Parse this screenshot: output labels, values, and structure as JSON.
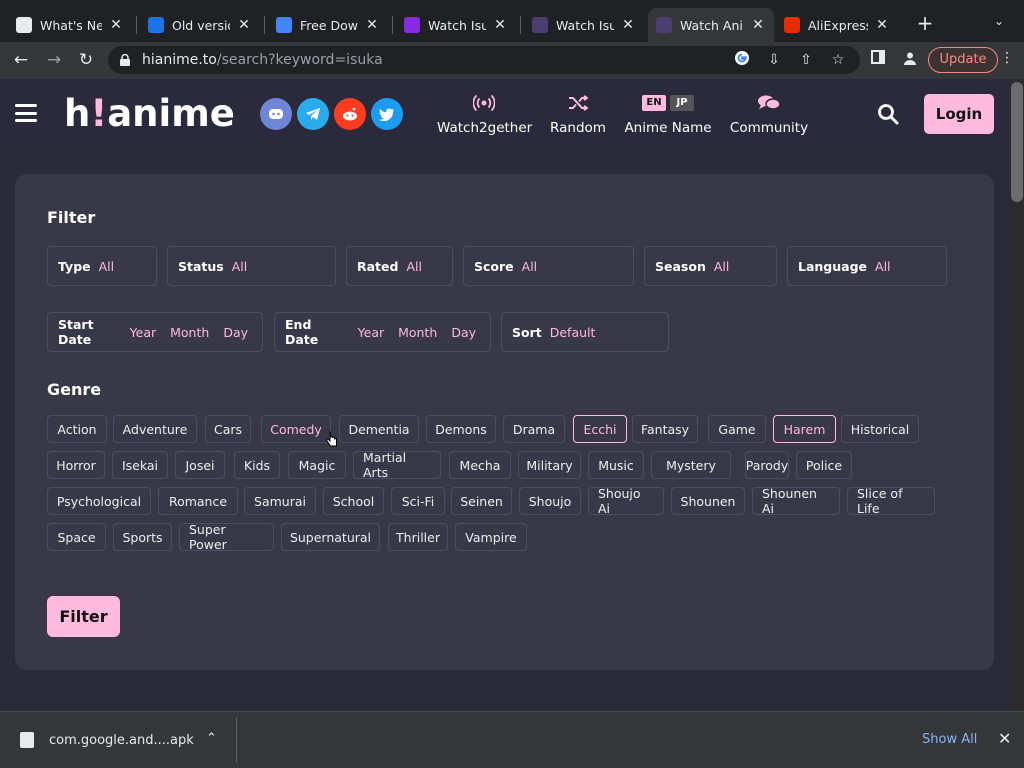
{
  "browser": {
    "tabs": [
      {
        "title": "What's New",
        "icon": "chrome-icon",
        "color": "#e8eaed"
      },
      {
        "title": "Old version",
        "icon": "ov-icon",
        "color": "#1a73e8"
      },
      {
        "title": "Free Downl",
        "icon": "download-site-icon",
        "color": "#4285f4"
      },
      {
        "title": "Watch Isuc",
        "icon": "play-icon",
        "color": "#8a2be2"
      },
      {
        "title": "Watch Isuc",
        "icon": "hianime-icon",
        "color": "#4b3f72"
      },
      {
        "title": "Watch Anim",
        "icon": "hianime-icon",
        "color": "#4b3f72"
      },
      {
        "title": "AliExpress",
        "icon": "aliexpress-icon",
        "color": "#e62e04"
      }
    ],
    "url_host": "hianime.to",
    "url_path": "/search?keyword=isuka",
    "update_label": "Update"
  },
  "site": {
    "logo_pre": "h",
    "logo_bang": "!",
    "logo_post": "anime",
    "nav": [
      {
        "label": "Watch2gether",
        "icon": "broadcast-icon"
      },
      {
        "label": "Random",
        "icon": "shuffle-icon"
      },
      {
        "label": "Anime Name",
        "icon": "language-switch-icon",
        "lang_en": "EN",
        "lang_jp": "JP"
      },
      {
        "label": "Community",
        "icon": "chat-bubbles-icon"
      }
    ],
    "login_label": "Login"
  },
  "filter": {
    "title": "Filter",
    "fields": [
      {
        "label": "Type",
        "value": "All"
      },
      {
        "label": "Status",
        "value": "All"
      },
      {
        "label": "Rated",
        "value": "All"
      },
      {
        "label": "Score",
        "value": "All"
      },
      {
        "label": "Season",
        "value": "All"
      },
      {
        "label": "Language",
        "value": "All"
      }
    ],
    "start_date": {
      "label": "Start Date",
      "year": "Year",
      "month": "Month",
      "day": "Day"
    },
    "end_date": {
      "label": "End Date",
      "year": "Year",
      "month": "Month",
      "day": "Day"
    },
    "sort": {
      "label": "Sort",
      "value": "Default"
    },
    "genre_title": "Genre",
    "genres": [
      "Action",
      "Adventure",
      "Cars",
      "Comedy",
      "Dementia",
      "Demons",
      "Drama",
      "Ecchi",
      "Fantasy",
      "Game",
      "Harem",
      "Historical",
      "Horror",
      "Isekai",
      "Josei",
      "Kids",
      "Magic",
      "Martial Arts",
      "Mecha",
      "Military",
      "Music",
      "Mystery",
      "Parody",
      "Police",
      "Psychological",
      "Romance",
      "Samurai",
      "School",
      "Sci-Fi",
      "Seinen",
      "Shoujo",
      "Shoujo Ai",
      "Shounen",
      "Shounen Ai",
      "Slice of Life",
      "Space",
      "Sports",
      "Super Power",
      "Supernatural",
      "Thriller",
      "Vampire"
    ],
    "selected_genres": [
      "Ecchi",
      "Harem"
    ],
    "hovered_genre": "Comedy",
    "submit_label": "Filter"
  },
  "downloads": {
    "file_name": "com.google.and....apk",
    "show_all_label": "Show All"
  },
  "colors": {
    "accent": "#ffbade",
    "panel": "#393848",
    "header": "#2b2a3c"
  }
}
